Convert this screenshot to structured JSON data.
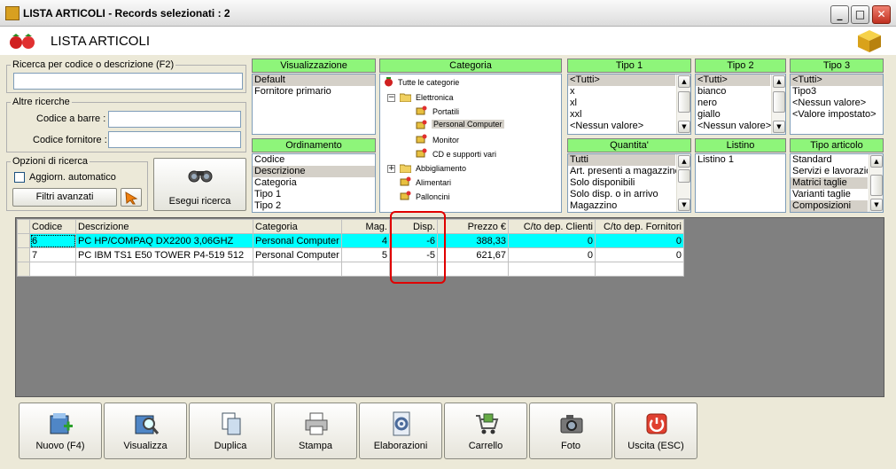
{
  "window": {
    "title": "LISTA ARTICOLI - Records selezionati : 2",
    "min": "_",
    "max": "□",
    "close": "✕"
  },
  "header": {
    "title": "LISTA ARTICOLI"
  },
  "search": {
    "legend": "Ricerca per codice o descrizione (F2)",
    "value": ""
  },
  "other": {
    "legend": "Altre ricerche",
    "barcode_label": "Codice a barre :",
    "supplier_label": "Codice fornitore :",
    "barcode_value": "",
    "supplier_value": ""
  },
  "options": {
    "legend": "Opzioni di ricerca",
    "auto_label": "Aggiorn. automatico",
    "filters_button": "Filtri avanzati",
    "search_button": "Esegui ricerca"
  },
  "visualizzazione": {
    "header": "Visualizzazione",
    "items": [
      "Default",
      "Fornitore primario"
    ],
    "selected": 0
  },
  "ordinamento": {
    "header": "Ordinamento",
    "items": [
      "Codice",
      "Descrizione",
      "Categoria",
      "Tipo 1",
      "Tipo 2"
    ],
    "selected": 1
  },
  "categoria": {
    "header": "Categoria",
    "root": "Tutte le categorie",
    "nodes": [
      "Elettronica",
      "Portatili",
      "Personal Computer",
      "Monitor",
      "CD e supporti vari",
      "Abbigliamento",
      "Alimentari",
      "Palloncini"
    ],
    "selected": "Personal Computer",
    "expand": "−",
    "collapse": "+"
  },
  "tipo1": {
    "header": "Tipo 1",
    "items": [
      "<Tutti>",
      "x",
      "xl",
      "xxl",
      "<Nessun valore>"
    ],
    "selected": 0
  },
  "tipo2": {
    "header": "Tipo 2",
    "items": [
      "<Tutti>",
      "bianco",
      "nero",
      "giallo",
      "<Nessun valore>"
    ],
    "selected": 0
  },
  "tipo3": {
    "header": "Tipo 3",
    "items": [
      "<Tutti>",
      "Tipo3",
      "<Nessun valore>",
      "<Valore impostato>"
    ],
    "selected": 0
  },
  "quantita": {
    "header": "Quantita'",
    "items": [
      "Tutti",
      "Art. presenti a magazzino",
      "Solo disponibili",
      "Solo disp. o in arrivo",
      "Magazzino"
    ],
    "selected": 0
  },
  "listino": {
    "header": "Listino",
    "items": [
      "Listino 1"
    ],
    "selected": 0
  },
  "tipo_articolo": {
    "header": "Tipo articolo",
    "items": [
      "Standard",
      "Servizi e lavorazio",
      "Matrici taglie",
      "Varianti taglie",
      "Composizioni"
    ],
    "selected": [
      2,
      4
    ]
  },
  "table": {
    "columns": [
      "Codice",
      "Descrizione",
      "Categoria",
      "Mag.",
      "Disp.",
      "Prezzo €",
      "C/to dep. Clienti",
      "C/to dep. Fornitori"
    ],
    "rows": [
      [
        "6",
        "PC HP/COMPAQ DX2200 3,06GHZ",
        "Personal Computer",
        "4",
        "-6",
        "388,33",
        "0",
        "0"
      ],
      [
        "7",
        "PC IBM TS1 E50 TOWER P4-519 512",
        "Personal Computer",
        "5",
        "-5",
        "621,67",
        "0",
        "0"
      ]
    ],
    "highlighted_row": 0
  },
  "toolbar": {
    "buttons": [
      "Nuovo (F4)",
      "Visualizza",
      "Duplica",
      "Stampa",
      "Elaborazioni",
      "Carrello",
      "Foto",
      "Uscita (ESC)"
    ]
  },
  "colors": {
    "panel_header": "#8ef57a",
    "highlight_row": "#00ffff",
    "annotation": "#e00000"
  }
}
